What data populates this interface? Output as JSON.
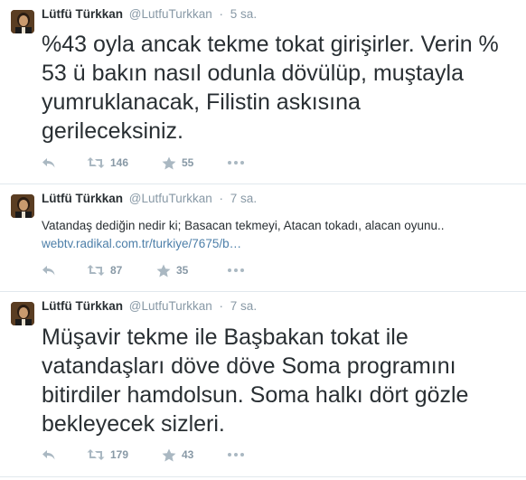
{
  "tweets": [
    {
      "name": "Lütfü Türkkan",
      "handle": "@LutfuTurkkan",
      "separator": "·",
      "time": "5 sa.",
      "text_lines": [
        "%43 oyla ancak tekme tokat girişirler. Verin %",
        "53 ü bakın nasıl odunla dövülüp, muştayla",
        "yumruklanacak, Filistin askısına",
        "gerileceksiniz."
      ],
      "retweets": "146",
      "favorites": "55"
    },
    {
      "name": "Lütfü Türkkan",
      "handle": "@LutfuTurkkan",
      "separator": "·",
      "time": "7 sa.",
      "text": "Vatandaş dediğin nedir ki; Basacan tekmeyi, Atacan tokadı, alacan oyunu..",
      "link": "webtv.radikal.com.tr/turkiye/7675/b…",
      "retweets": "87",
      "favorites": "35"
    },
    {
      "name": "Lütfü Türkkan",
      "handle": "@LutfuTurkkan",
      "separator": "·",
      "time": "7 sa.",
      "text_lines": [
        "Müşavir tekme ile Başbakan tokat ile",
        "vatandaşları döve döve Soma programını",
        "bitirdiler hamdolsun. Soma halkı dört gözle",
        "bekleyecek sizleri."
      ],
      "retweets": "179",
      "favorites": "43"
    }
  ],
  "icons": {
    "reply": "reply-icon",
    "retweet": "retweet-icon",
    "favorite": "star-icon",
    "more": "more-dots-icon"
  },
  "colors": {
    "name": "#292f33",
    "muted": "#8899a6",
    "link": "#4d7fa9",
    "divider": "#e1e8ed"
  }
}
